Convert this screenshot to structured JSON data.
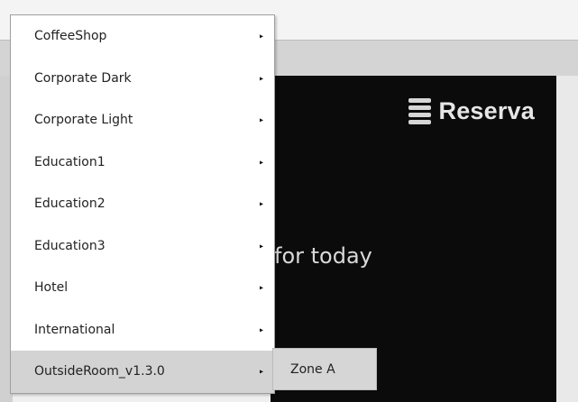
{
  "menu": {
    "items": [
      {
        "label": "CoffeeShop"
      },
      {
        "label": "Corporate Dark"
      },
      {
        "label": "Corporate Light"
      },
      {
        "label": "Education1"
      },
      {
        "label": "Education2"
      },
      {
        "label": "Education3"
      },
      {
        "label": "Hotel"
      },
      {
        "label": "International"
      },
      {
        "label": "OutsideRoom_v1.3.0"
      }
    ],
    "arrow": "▸",
    "submenu": {
      "label": "Zone A"
    }
  },
  "preview": {
    "logo_text": "Reserva",
    "tagline": "for today"
  }
}
